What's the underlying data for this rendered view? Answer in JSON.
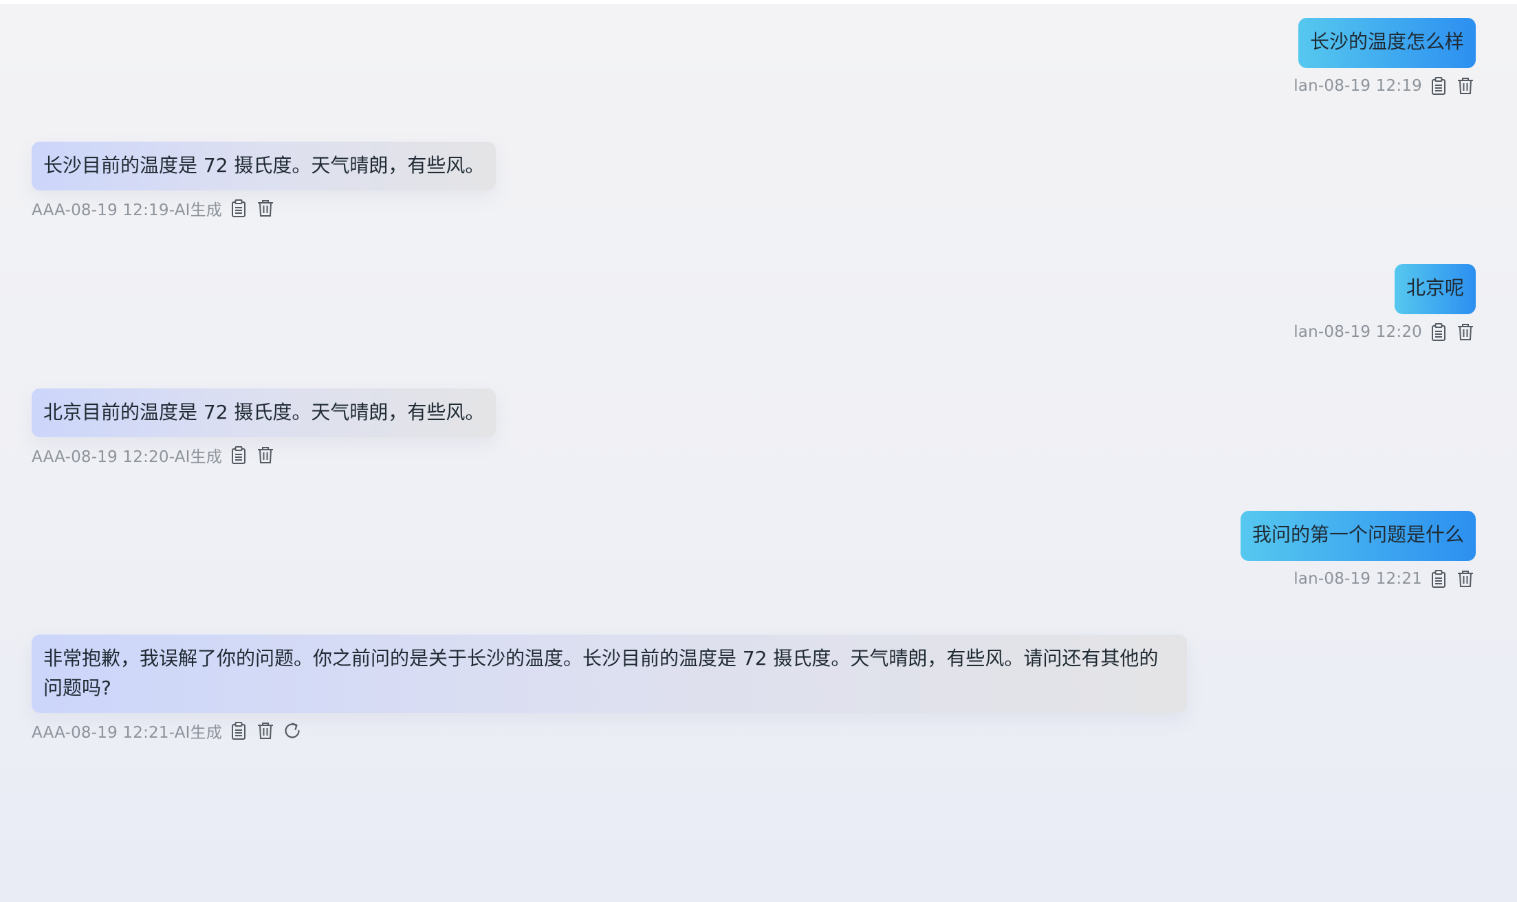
{
  "messages": [
    {
      "role": "user",
      "text": "长沙的温度怎么样",
      "meta": "lan-08-19 12:19",
      "actions": [
        "clipboard-icon",
        "trash-icon"
      ]
    },
    {
      "role": "assistant",
      "text": "长沙目前的温度是 72 摄氏度。天气晴朗，有些风。",
      "meta": "AAA-08-19 12:19-AI生成",
      "actions": [
        "clipboard-icon",
        "trash-icon"
      ]
    },
    {
      "role": "user",
      "text": "北京呢",
      "meta": "lan-08-19 12:20",
      "actions": [
        "clipboard-icon",
        "trash-icon"
      ]
    },
    {
      "role": "assistant",
      "text": "北京目前的温度是 72 摄氏度。天气晴朗，有些风。",
      "meta": "AAA-08-19 12:20-AI生成",
      "actions": [
        "clipboard-icon",
        "trash-icon"
      ]
    },
    {
      "role": "user",
      "text": "我问的第一个问题是什么",
      "meta": "lan-08-19 12:21",
      "actions": [
        "clipboard-icon",
        "trash-icon"
      ]
    },
    {
      "role": "assistant",
      "text": "非常抱歉，我误解了你的问题。你之前问的是关于长沙的温度。长沙目前的温度是 72 摄氏度。天气晴朗，有些风。请问还有其他的问题吗?",
      "meta": "AAA-08-19 12:21-AI生成",
      "actions": [
        "clipboard-icon",
        "trash-icon",
        "refresh-icon"
      ]
    }
  ],
  "colors": {
    "user_bubble_start": "#56c8ef",
    "user_bubble_end": "#2c8ff0",
    "ai_bubble_start": "#ccd6fb",
    "ai_bubble_end": "#e4e4e6",
    "meta_text": "#8d939b",
    "icon": "#555b62"
  }
}
